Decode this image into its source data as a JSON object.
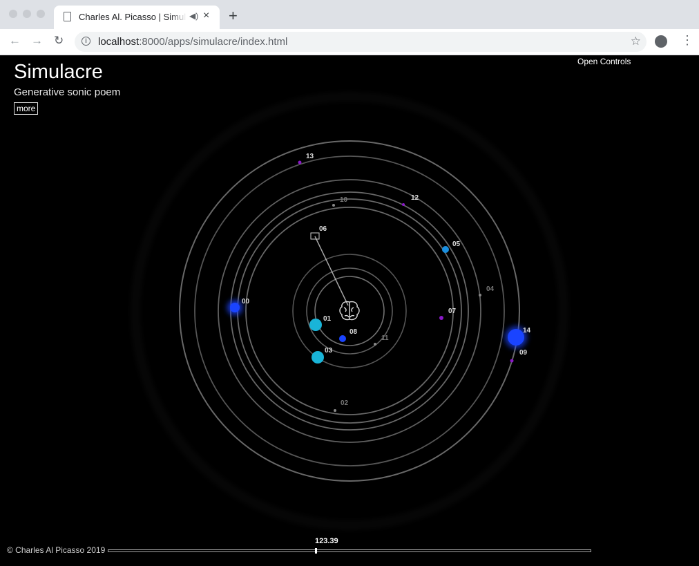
{
  "browser": {
    "tab_title": "Charles Al. Picasso | Simulacre",
    "url_host": "localhost",
    "url_rest": ":8000/apps/simulacre/index.html",
    "new_tab": "+",
    "close_tab": "×",
    "speaker": "◀)",
    "back": "←",
    "forward": "→",
    "reload": "↻",
    "star": "☆",
    "menu": "⋮"
  },
  "header": {
    "title": "Simulacre",
    "subtitle": "Generative sonic poem",
    "more_label": "more"
  },
  "controls": {
    "open_label": "Open Controls"
  },
  "orbit_labels": [
    "13",
    "12",
    "10",
    "06",
    "05",
    "04",
    "00",
    "07",
    "14",
    "09",
    "01",
    "08",
    "11",
    "03",
    "02"
  ],
  "footer": {
    "copyright": "© Charles Al Picasso 2019",
    "time": "123.39",
    "progress": 0.43
  },
  "colors": {
    "blue": "#1a44ff",
    "cyan": "#19b4d8",
    "purple": "#8a18c8",
    "ring": "#bdbdbd"
  }
}
